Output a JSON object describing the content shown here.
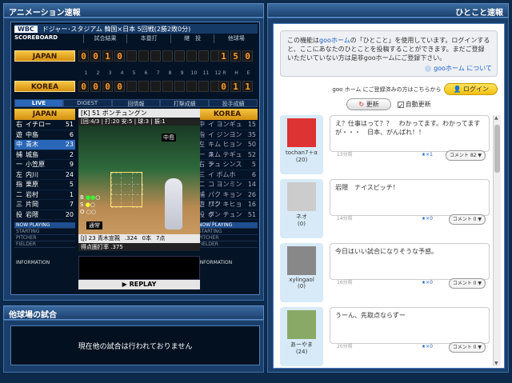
{
  "headers": {
    "left": "アニメーション速報",
    "right": "ひとこと速報",
    "bottom": "他球場の試合"
  },
  "scoreboard": {
    "wbc": "WBC",
    "title": "ドジャー･スタジアム 韓国×日本 5回戦(2勝2敗0分)",
    "tabs": [
      "SCOREBOARD",
      "試合結果",
      "本塁打",
      "継　投",
      "他球場"
    ],
    "innings": [
      "1",
      "2",
      "3",
      "4",
      "5",
      "6",
      "7",
      "8",
      "9",
      "10",
      "11",
      "12"
    ],
    "rhe_labels": [
      "R",
      "H",
      "E"
    ],
    "japan": {
      "name": "JAPAN",
      "innings": [
        "0",
        "0",
        "1",
        "0",
        "",
        "",
        "",
        "",
        "",
        "",
        "",
        ""
      ],
      "r": "1",
      "h": "5",
      "e": "0"
    },
    "korea": {
      "name": "KOREA",
      "innings": [
        "0",
        "0",
        "0",
        "0",
        "",
        "",
        "",
        "",
        "",
        "",
        "",
        ""
      ],
      "r": "0",
      "h": "1",
      "e": "1"
    }
  },
  "sub_tabs": [
    "LIVE",
    "DIGEST",
    "回情報",
    "打撃成績",
    "投手成績"
  ],
  "japan_lineup": {
    "header": "JAPAN",
    "rows": [
      {
        "pos": "右",
        "name": "イチロー",
        "num": "51"
      },
      {
        "pos": "遊",
        "name": "中島",
        "num": "6"
      },
      {
        "pos": "中",
        "name": "青木",
        "num": "23"
      },
      {
        "pos": "捕",
        "name": "城島",
        "num": "2"
      },
      {
        "pos": "一",
        "name": "小笠原",
        "num": "9"
      },
      {
        "pos": "左",
        "name": "内川",
        "num": "24"
      },
      {
        "pos": "指",
        "name": "栗原",
        "num": "5"
      },
      {
        "pos": "二",
        "name": "岩村",
        "num": "1"
      },
      {
        "pos": "三",
        "name": "片岡",
        "num": "7"
      },
      {
        "pos": "投",
        "name": "岩隈",
        "num": "20"
      }
    ]
  },
  "korea_lineup": {
    "header": "KOREA",
    "rows": [
      {
        "pos": "中",
        "name": "イ ヨンギュ",
        "num": "15"
      },
      {
        "pos": "指",
        "name": "イ ジンヨン",
        "num": "35"
      },
      {
        "pos": "左",
        "name": "キム ヒョンス",
        "num": "50"
      },
      {
        "pos": "一",
        "name": "キム テギュン",
        "num": "52"
      },
      {
        "pos": "右",
        "name": "チュ シンス",
        "num": "5"
      },
      {
        "pos": "三",
        "name": "イ ボムホ",
        "num": "6"
      },
      {
        "pos": "二",
        "name": "コ ヨンミン",
        "num": "14"
      },
      {
        "pos": "捕",
        "name": "パク キョンワン",
        "num": "26"
      },
      {
        "pos": "遊",
        "name": "パク キヒョク",
        "num": "16"
      },
      {
        "pos": "投",
        "name": "ボン チュングン",
        "num": "51"
      }
    ]
  },
  "status_labels": [
    "NOW PLAYING",
    "STARTING",
    "PITCHER",
    "FIELDER"
  ],
  "info_label": "INFORMATION",
  "center": {
    "pitcher": "[K] 51 ボンチュングン",
    "count": "[回:4/3 | 打:20 安:5 | 球:3 | 振:1",
    "runner": "中島",
    "bso": {
      "b": "B",
      "s": "S",
      "o": "O"
    },
    "batting": "通常",
    "batter_num": "[J] 23 青木宣親",
    "batter_avg": ".324",
    "batter_hr": "0本",
    "batter_rbi": "7点",
    "scoring_avg": "得点圏打率 .375",
    "replay": "▶ REPLAY"
  },
  "other_games": "現在他の試合は行われておりません",
  "hitokoto": {
    "notice_1": "この機能は",
    "notice_goo": "gooホーム",
    "notice_2": "の「ひとこと」を使用しています。ログインすると、ここにあなたのひとことを投稿することができます。まだご登録いただいていない方は是非gooホームにご登録下さい。",
    "about": "gooホーム について",
    "login_prompt": "goo ホーム にご登録済みの方はこちらから",
    "login": "ログイン",
    "refresh": "更新",
    "auto_refresh": "自動更新",
    "entries": [
      {
        "user": "tochan7＋α",
        "score": "(20)",
        "message": "え？仕事はって？？　わかってます。わかってますが・・・　日本、がんばれ！！",
        "time": "13分前",
        "stars": "★×1",
        "comment": "コメント 82"
      },
      {
        "user": "ネオ",
        "score": "(0)",
        "message": "岩隈　ナイスピッチ！",
        "time": "14分前",
        "stars": "★×0",
        "comment": "コメント 0"
      },
      {
        "user": "xylingaol",
        "score": "(0)",
        "message": "今日はいい試合になりそうな予感。",
        "time": "16分前",
        "stars": "★×0",
        "comment": "コメント 0"
      },
      {
        "user": "あーやま",
        "score": "(24)",
        "message": "うーん、先取点ならずー",
        "time": "20分前",
        "stars": "★×0",
        "comment": "コメント 0"
      }
    ]
  },
  "colors": {
    "panel": "#1a3f6a",
    "team_gold": "#f4c542",
    "digit": "#ff9a2a",
    "accent": "#2a67b8"
  }
}
